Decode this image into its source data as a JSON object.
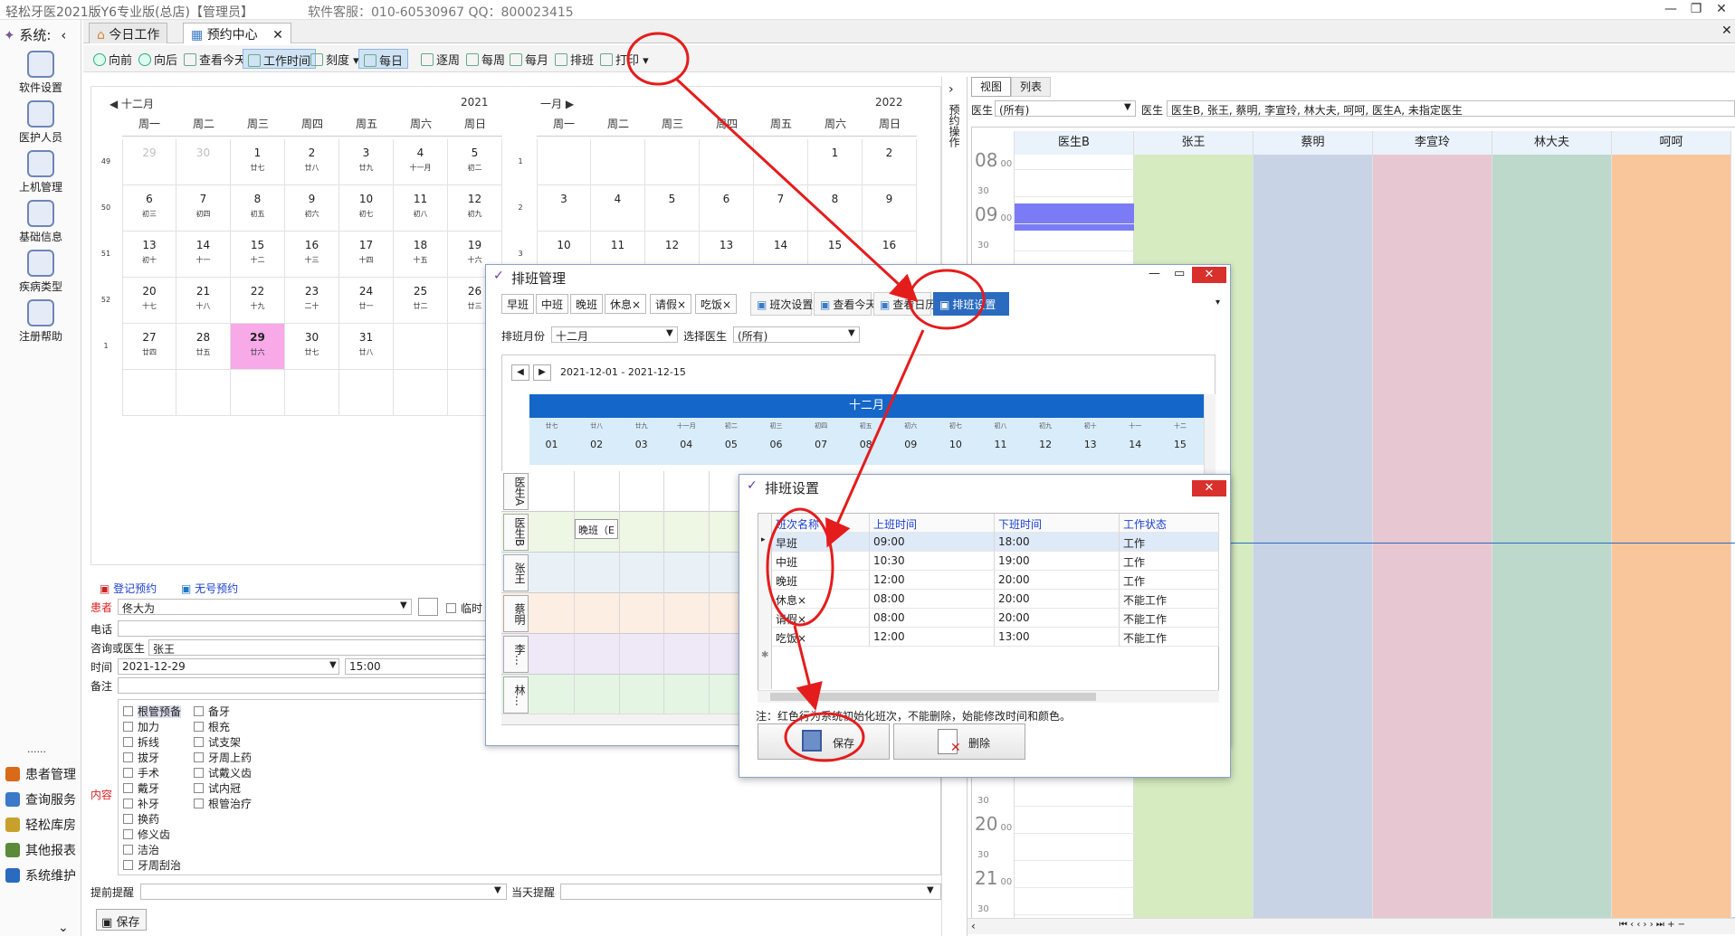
{
  "titlebar": {
    "title": "轻松牙医2021版Y6专业版(总店)【管理员】",
    "service": "软件客服：010-60530967  QQ：800023415"
  },
  "leftbar": {
    "system_label": "系统:",
    "items": [
      {
        "label": "软件设置",
        "icon": "gears-icon"
      },
      {
        "label": "医护人员",
        "icon": "people-icon"
      },
      {
        "label": "上机管理",
        "icon": "lock-icon"
      },
      {
        "label": "基础信息",
        "icon": "gear-icon"
      },
      {
        "label": "疾病类型",
        "icon": "tree-icon"
      },
      {
        "label": "注册帮助",
        "icon": "help-icon"
      }
    ],
    "bottom": [
      {
        "label": "患者管理",
        "color": "#d86a1a"
      },
      {
        "label": "查询服务",
        "color": "#3a7ac8"
      },
      {
        "label": "轻松库房",
        "color": "#c7a12b"
      },
      {
        "label": "其他报表",
        "color": "#5a8a3a"
      },
      {
        "label": "系统维护",
        "color": "#2a6bbf"
      }
    ],
    "dots": "......"
  },
  "tabs": [
    {
      "label": "今日工作"
    },
    {
      "label": "预约中心"
    }
  ],
  "toolbar": [
    {
      "label": "向前",
      "on": false
    },
    {
      "label": "向后",
      "on": false
    },
    {
      "label": "查看今天",
      "on": false
    },
    {
      "label": "工作时间",
      "on": true
    },
    {
      "label": "刻度 ▾",
      "on": false
    },
    {
      "label": "每日",
      "on": true
    },
    {
      "label": "逐周",
      "on": false
    },
    {
      "label": "每周",
      "on": false
    },
    {
      "label": "每月",
      "on": false
    },
    {
      "label": "排班",
      "on": false
    },
    {
      "label": "打印 ▾",
      "on": false
    }
  ],
  "calendar": {
    "dec": {
      "month": "十二月",
      "year": "2021"
    },
    "jan": {
      "month": "一月",
      "year": "2022"
    },
    "dow": [
      "周一",
      "周二",
      "周三",
      "周四",
      "周五",
      "周六",
      "周日"
    ],
    "dec_weeks": [
      "49",
      "50",
      "51",
      "52",
      "1",
      ""
    ],
    "jan_weeks": [
      "1",
      "2",
      "3"
    ],
    "dec_cells": [
      [
        {
          "d": "29",
          "l": "",
          "g": true
        },
        {
          "d": "30",
          "l": "",
          "g": true
        },
        {
          "d": "1",
          "l": "廿七"
        },
        {
          "d": "2",
          "l": "廿八"
        },
        {
          "d": "3",
          "l": "廿九"
        },
        {
          "d": "4",
          "l": "十一月"
        },
        {
          "d": "5",
          "l": "初二"
        }
      ],
      [
        {
          "d": "6",
          "l": "初三"
        },
        {
          "d": "7",
          "l": "初四"
        },
        {
          "d": "8",
          "l": "初五"
        },
        {
          "d": "9",
          "l": "初六"
        },
        {
          "d": "10",
          "l": "初七"
        },
        {
          "d": "11",
          "l": "初八"
        },
        {
          "d": "12",
          "l": "初九"
        }
      ],
      [
        {
          "d": "13",
          "l": "初十"
        },
        {
          "d": "14",
          "l": "十一"
        },
        {
          "d": "15",
          "l": "十二"
        },
        {
          "d": "16",
          "l": "十三"
        },
        {
          "d": "17",
          "l": "十四"
        },
        {
          "d": "18",
          "l": "十五"
        },
        {
          "d": "19",
          "l": "十六"
        }
      ],
      [
        {
          "d": "20",
          "l": "十七"
        },
        {
          "d": "21",
          "l": "十八"
        },
        {
          "d": "22",
          "l": "十九"
        },
        {
          "d": "23",
          "l": "二十"
        },
        {
          "d": "24",
          "l": "廿一"
        },
        {
          "d": "25",
          "l": "廿二"
        },
        {
          "d": "26",
          "l": "廿三"
        }
      ],
      [
        {
          "d": "27",
          "l": "廿四"
        },
        {
          "d": "28",
          "l": "廿五"
        },
        {
          "d": "29",
          "l": "廿六",
          "t": true
        },
        {
          "d": "30",
          "l": "廿七"
        },
        {
          "d": "31",
          "l": "廿八"
        },
        {
          "d": "",
          "l": ""
        },
        {
          "d": "",
          "l": ""
        }
      ],
      [
        {
          "d": "",
          "l": ""
        },
        {
          "d": "",
          "l": ""
        },
        {
          "d": "",
          "l": ""
        },
        {
          "d": "",
          "l": ""
        },
        {
          "d": "",
          "l": ""
        },
        {
          "d": "",
          "l": ""
        },
        {
          "d": "",
          "l": ""
        }
      ]
    ],
    "jan_cells": [
      [
        {
          "d": "",
          "l": ""
        },
        {
          "d": "",
          "l": ""
        },
        {
          "d": "",
          "l": ""
        },
        {
          "d": "",
          "l": ""
        },
        {
          "d": "",
          "l": ""
        },
        {
          "d": "1",
          "l": ""
        },
        {
          "d": "2",
          "l": ""
        }
      ],
      [
        {
          "d": "3",
          "l": ""
        },
        {
          "d": "4",
          "l": ""
        },
        {
          "d": "5",
          "l": ""
        },
        {
          "d": "6",
          "l": ""
        },
        {
          "d": "7",
          "l": ""
        },
        {
          "d": "8",
          "l": ""
        },
        {
          "d": "9",
          "l": ""
        }
      ],
      [
        {
          "d": "10",
          "l": ""
        },
        {
          "d": "11",
          "l": ""
        },
        {
          "d": "12",
          "l": ""
        },
        {
          "d": "13",
          "l": ""
        },
        {
          "d": "14",
          "l": ""
        },
        {
          "d": "15",
          "l": ""
        },
        {
          "d": "16",
          "l": ""
        }
      ]
    ]
  },
  "form": {
    "reg_link": "登记预约",
    "noreg_link": "无号预约",
    "patient_label": "患者",
    "patient_value": "佟大为",
    "temp_label": "临时",
    "phone_label": "电话",
    "doctor_label": "咨询或医生",
    "doctor_value": "张王",
    "time_label": "时间",
    "date_value": "2021-12-29",
    "time_value": "15:00",
    "note_label": "备注",
    "content_label": "内容",
    "items_col1": [
      "根管预备",
      "加力",
      "拆线",
      "拔牙",
      "手术",
      "戴牙",
      "补牙",
      "换药",
      "修义齿",
      "洁治",
      "牙周刮治"
    ],
    "items_col2": [
      "备牙",
      "根充",
      "试支架",
      "牙周上药",
      "试戴义齿",
      "试内冠",
      "根管治疗"
    ],
    "pre_remind": "提前提醒",
    "day_remind": "当天提醒",
    "save": "保存"
  },
  "sidepanel": {
    "label": "预约操作"
  },
  "schedule": {
    "tabs": [
      "视图",
      "列表"
    ],
    "doctor_label": "医生",
    "doctor_select": "(所有)",
    "doctor_label2": "医生",
    "doctor_list": "医生B, 张王, 蔡明, 李宣玲, 林大夫, 呵呵, 医生A, 未指定医生",
    "columns": [
      {
        "name": "医生B",
        "color": "#ffffff"
      },
      {
        "name": "张王",
        "color": "#d6ebc0"
      },
      {
        "name": "蔡明",
        "color": "#c9d3e6"
      },
      {
        "name": "李宣玲",
        "color": "#e7c7d2"
      },
      {
        "name": "林大夫",
        "color": "#bcd9cc"
      },
      {
        "name": "呵呵",
        "color": "#f9c59b"
      }
    ],
    "times_top": [
      {
        "h": "08",
        "m": "00"
      },
      {
        "h": "",
        "m": "30"
      },
      {
        "h": "09",
        "m": "00"
      },
      {
        "h": "",
        "m": "30"
      }
    ],
    "times_bottom": [
      {
        "h": "",
        "m": "30"
      },
      {
        "h": "20",
        "m": "00"
      },
      {
        "h": "",
        "m": "30"
      },
      {
        "h": "21",
        "m": "00"
      },
      {
        "h": "",
        "m": "30"
      }
    ],
    "booked_color": "#7b7cf5"
  },
  "dlg1": {
    "title": "排班管理",
    "chips": [
      "早班",
      "中班",
      "晚班",
      "休息×",
      "请假×",
      "吃饭×"
    ],
    "buttons": [
      "班次设置",
      "查看今天",
      "查看日历",
      "排班设置"
    ],
    "month_label": "排班月份",
    "month_value": "十二月",
    "doctor_label": "选择医生",
    "doctor_value": "(所有)",
    "range": "2021-12-01  -  2021-12-15",
    "month_header": "十二月",
    "day_lunar": [
      "廿七",
      "廿八",
      "廿九",
      "十一月",
      "初二",
      "初三",
      "初四",
      "初五",
      "初六",
      "初七",
      "初八",
      "初九",
      "初十",
      "十一",
      "十二"
    ],
    "days": [
      "01",
      "02",
      "03",
      "04",
      "05",
      "06",
      "07",
      "08",
      "09",
      "10",
      "11",
      "12",
      "13",
      "14",
      "15"
    ],
    "doctors": [
      "医生A",
      "医生B",
      "张王",
      "蔡明",
      "李…",
      "林…"
    ],
    "row_colors": [
      "#ffffff",
      "#eef6e4",
      "#e9f1f7",
      "#fdeee3",
      "#efe8f7",
      "#e4f5e4"
    ],
    "shift_cell": "晚班（E"
  },
  "dlg2": {
    "title": "排班设置",
    "headers": [
      "班次名称",
      "上班时间",
      "下班时间",
      "工作状态"
    ],
    "rows": [
      [
        "早班",
        "09:00",
        "18:00",
        "工作"
      ],
      [
        "中班",
        "10:30",
        "19:00",
        "工作"
      ],
      [
        "晚班",
        "12:00",
        "20:00",
        "工作"
      ],
      [
        "休息×",
        "08:00",
        "20:00",
        "不能工作"
      ],
      [
        "请假×",
        "08:00",
        "20:00",
        "不能工作"
      ],
      [
        "吃饭×",
        "12:00",
        "13:00",
        "不能工作"
      ]
    ],
    "note": "注：红色行为系统初始化班次，不能删除，始能修改时间和颜色。",
    "save": "保存",
    "delete": "删除"
  },
  "colors": {
    "annotation": "#e51c1c",
    "accent": "#2a6bbf",
    "today": "#f7a9e8"
  }
}
